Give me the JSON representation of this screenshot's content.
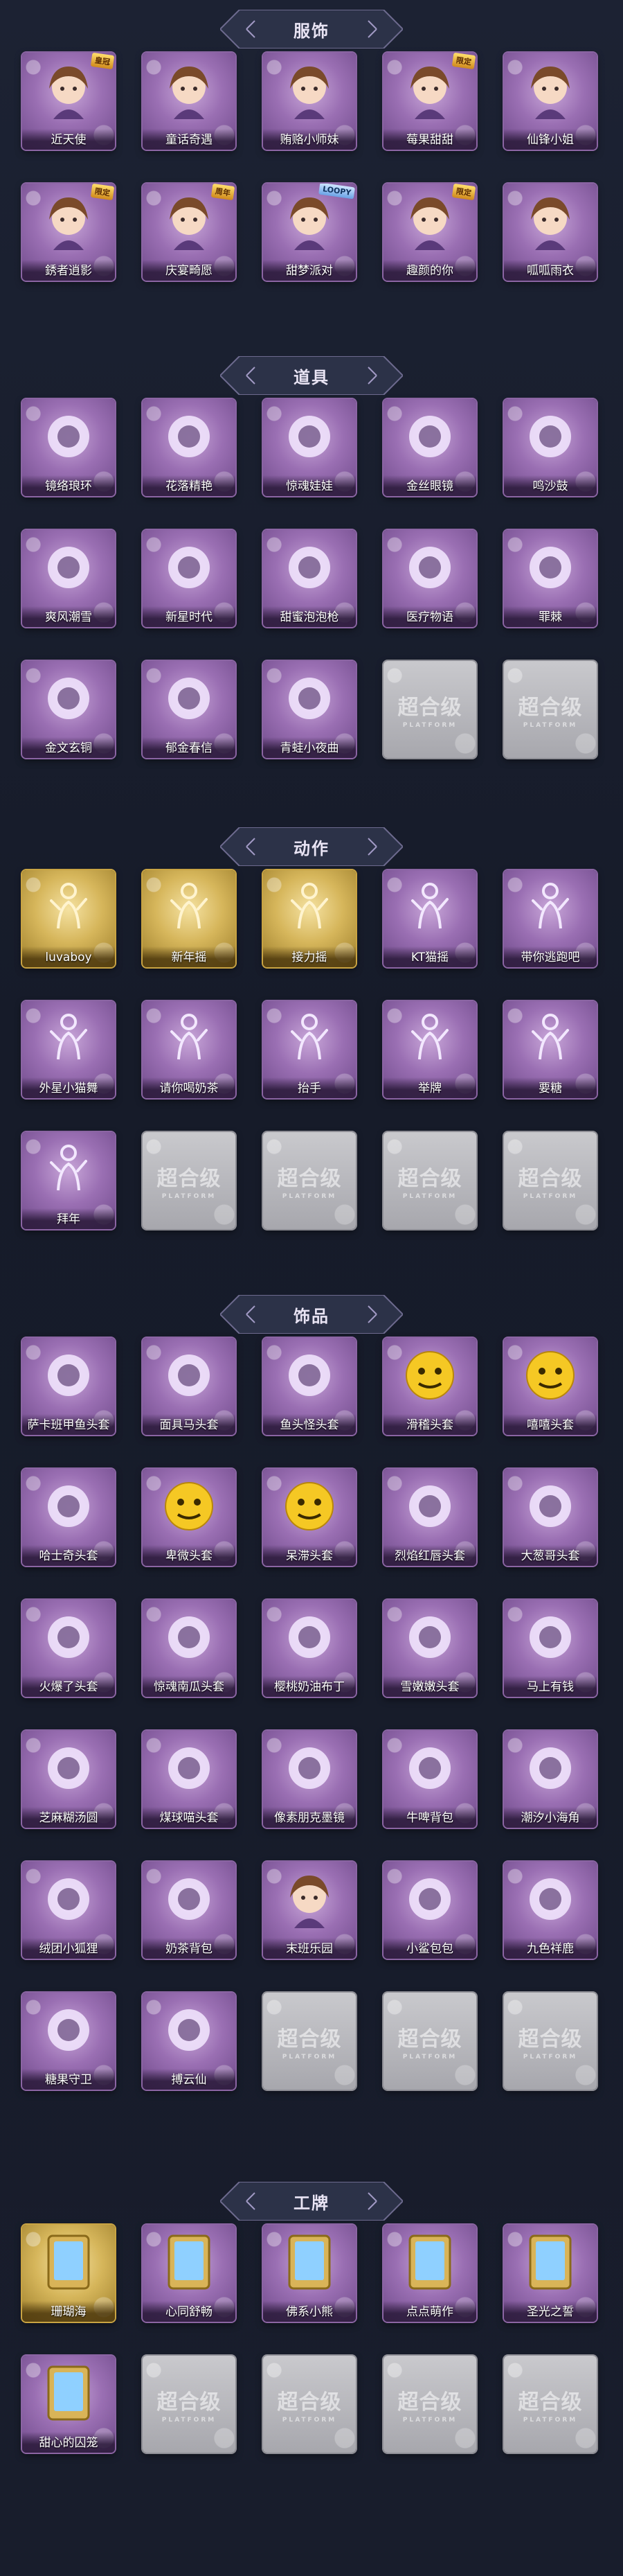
{
  "colors": {
    "background": "#1a1f2e",
    "header_bar": "#2c3248",
    "purple_card": "#9a6fb3",
    "gold_card": "#d6b65b",
    "empty_card": "#b8b8bd"
  },
  "sections": [
    {
      "title": "服饰",
      "items": [
        {
          "name": "近天使",
          "rarity": "purple",
          "badge": "皇冠",
          "icon": "angel-doll-icon"
        },
        {
          "name": "童话奇遇",
          "rarity": "purple",
          "badge": "",
          "icon": "fairy-doll-icon"
        },
        {
          "name": "贿赂小师妹",
          "rarity": "purple",
          "badge": "",
          "icon": "maid-doll-icon"
        },
        {
          "name": "莓果甜甜",
          "rarity": "purple",
          "badge": "限定",
          "icon": "berry-doll-icon"
        },
        {
          "name": "仙锋小姐",
          "rarity": "purple",
          "badge": "",
          "icon": "lady-doll-icon"
        },
        {
          "name": "銹者逍影",
          "rarity": "purple",
          "badge": "限定",
          "icon": "shadow-doll-icon"
        },
        {
          "name": "庆宴畸愿",
          "rarity": "purple",
          "badge": "周年",
          "icon": "cake-doll-icon"
        },
        {
          "name": "甜梦派对",
          "rarity": "purple",
          "badge": "LOOPY",
          "icon": "party-doll-icon"
        },
        {
          "name": "趣颜的你",
          "rarity": "purple",
          "badge": "限定",
          "icon": "cowgirl-doll-icon"
        },
        {
          "name": "呱呱雨衣",
          "rarity": "purple",
          "badge": "",
          "icon": "frog-raincoat-icon"
        }
      ]
    },
    {
      "title": "道具",
      "items": [
        {
          "name": "镜络琅环",
          "rarity": "purple",
          "badge": "",
          "icon": "ring-bow-icon"
        },
        {
          "name": "花落精艳",
          "rarity": "purple",
          "badge": "",
          "icon": "flower-wand-icon"
        },
        {
          "name": "惊魂娃娃",
          "rarity": "purple",
          "badge": "",
          "icon": "skull-ball-icon"
        },
        {
          "name": "金丝眼镜",
          "rarity": "purple",
          "badge": "",
          "icon": "glasses-icon"
        },
        {
          "name": "鸣沙鼓",
          "rarity": "purple",
          "badge": "",
          "icon": "drum-icon"
        },
        {
          "name": "爽风潮雪",
          "rarity": "purple",
          "badge": "",
          "icon": "snow-blower-icon"
        },
        {
          "name": "新星时代",
          "rarity": "purple",
          "badge": "",
          "icon": "revolver-icon"
        },
        {
          "name": "甜蜜泡泡枪",
          "rarity": "purple",
          "badge": "",
          "icon": "bubble-gun-icon"
        },
        {
          "name": "医疗物语",
          "rarity": "purple",
          "badge": "",
          "icon": "medkit-icon"
        },
        {
          "name": "罪棘",
          "rarity": "purple",
          "badge": "",
          "icon": "staff-icon"
        },
        {
          "name": "金文玄铜",
          "rarity": "purple",
          "badge": "",
          "icon": "bronze-vessel-icon"
        },
        {
          "name": "郁金春信",
          "rarity": "purple",
          "badge": "",
          "icon": "paper-fan-icon"
        },
        {
          "name": "青蛙小夜曲",
          "rarity": "purple",
          "badge": "",
          "icon": "frog-icon"
        },
        {
          "name": "",
          "rarity": "empty",
          "badge": "",
          "icon": "empty-slot-icon"
        },
        {
          "name": "",
          "rarity": "empty",
          "badge": "",
          "icon": "empty-slot-icon"
        }
      ]
    },
    {
      "title": "动作",
      "items": [
        {
          "name": "luvaboy",
          "rarity": "gold",
          "badge": "",
          "icon": "pose-figure-icon"
        },
        {
          "name": "新年摇",
          "rarity": "gold",
          "badge": "",
          "icon": "pose-figure-icon"
        },
        {
          "name": "接力摇",
          "rarity": "gold",
          "badge": "",
          "icon": "pose-figure-icon"
        },
        {
          "name": "KT猫摇",
          "rarity": "purple",
          "badge": "",
          "icon": "pose-figure-icon"
        },
        {
          "name": "带你逃跑吧",
          "rarity": "purple",
          "badge": "",
          "icon": "pose-figure-icon"
        },
        {
          "name": "外星小猫舞",
          "rarity": "purple",
          "badge": "",
          "icon": "pose-figure-icon"
        },
        {
          "name": "请你喝奶茶",
          "rarity": "purple",
          "badge": "",
          "icon": "pose-figure-icon"
        },
        {
          "name": "抬手",
          "rarity": "purple",
          "badge": "",
          "icon": "pose-figure-icon"
        },
        {
          "name": "举牌",
          "rarity": "purple",
          "badge": "",
          "icon": "pose-figure-icon"
        },
        {
          "name": "要糖",
          "rarity": "purple",
          "badge": "",
          "icon": "pose-figure-icon"
        },
        {
          "name": "拜年",
          "rarity": "purple",
          "badge": "",
          "icon": "pose-figure-icon"
        },
        {
          "name": "",
          "rarity": "empty",
          "badge": "",
          "icon": "empty-slot-icon"
        },
        {
          "name": "",
          "rarity": "empty",
          "badge": "",
          "icon": "empty-slot-icon"
        },
        {
          "name": "",
          "rarity": "empty",
          "badge": "",
          "icon": "empty-slot-icon"
        },
        {
          "name": "",
          "rarity": "empty",
          "badge": "",
          "icon": "empty-slot-icon"
        }
      ]
    },
    {
      "title": "饰品",
      "items": [
        {
          "name": "萨卡班甲鱼头套",
          "rarity": "purple",
          "badge": "",
          "icon": "fish-head-icon"
        },
        {
          "name": "面具马头套",
          "rarity": "purple",
          "badge": "",
          "icon": "horse-head-icon"
        },
        {
          "name": "鱼头怪头套",
          "rarity": "purple",
          "badge": "",
          "icon": "fish-monster-icon"
        },
        {
          "name": "滑稽头套",
          "rarity": "purple",
          "badge": "",
          "icon": "smirk-face-icon"
        },
        {
          "name": "嘻嘻头套",
          "rarity": "purple",
          "badge": "",
          "icon": "grin-face-icon"
        },
        {
          "name": "哈士奇头套",
          "rarity": "purple",
          "badge": "",
          "icon": "husky-head-icon"
        },
        {
          "name": "卑微头套",
          "rarity": "purple",
          "badge": "",
          "icon": "sad-face-icon"
        },
        {
          "name": "呆滞头套",
          "rarity": "purple",
          "badge": "",
          "icon": "dazed-face-icon"
        },
        {
          "name": "烈焰红唇头套",
          "rarity": "purple",
          "badge": "",
          "icon": "lips-pikachu-icon"
        },
        {
          "name": "大葱哥头套",
          "rarity": "purple",
          "badge": "",
          "icon": "scallion-icon"
        },
        {
          "name": "火爆了头套",
          "rarity": "purple",
          "badge": "",
          "icon": "fire-spirit-icon"
        },
        {
          "name": "惊魂南瓜头套",
          "rarity": "purple",
          "badge": "",
          "icon": "pumpkin-icon"
        },
        {
          "name": "樱桃奶油布丁",
          "rarity": "purple",
          "badge": "",
          "icon": "pudding-icon"
        },
        {
          "name": "雪嫩嫩头套",
          "rarity": "purple",
          "badge": "",
          "icon": "snowman-icon"
        },
        {
          "name": "马上有钱",
          "rarity": "purple",
          "badge": "",
          "icon": "red-horse-icon"
        },
        {
          "name": "芝麻糊汤圆",
          "rarity": "purple",
          "badge": "",
          "icon": "dumpling-icon"
        },
        {
          "name": "煤球喵头套",
          "rarity": "purple",
          "badge": "",
          "icon": "cat-head-icon"
        },
        {
          "name": "像素朋克墨镜",
          "rarity": "purple",
          "badge": "",
          "icon": "pixel-glasses-icon"
        },
        {
          "name": "牛啤背包",
          "rarity": "purple",
          "badge": "",
          "icon": "cow-backpack-icon"
        },
        {
          "name": "潮汐小海角",
          "rarity": "purple",
          "badge": "",
          "icon": "blue-spirit-icon"
        },
        {
          "name": "绒团小狐狸",
          "rarity": "purple",
          "badge": "",
          "icon": "fox-charm-icon"
        },
        {
          "name": "奶茶背包",
          "rarity": "purple",
          "badge": "",
          "icon": "milktea-bag-icon"
        },
        {
          "name": "末班乐园",
          "rarity": "purple",
          "badge": "",
          "icon": "clown-doll-icon"
        },
        {
          "name": "小鲨包包",
          "rarity": "purple",
          "badge": "",
          "icon": "shark-bag-icon"
        },
        {
          "name": "九色祥鹿",
          "rarity": "purple",
          "badge": "",
          "icon": "deer-charm-icon"
        },
        {
          "name": "糖果守卫",
          "rarity": "purple",
          "badge": "",
          "icon": "candy-guard-icon"
        },
        {
          "name": "搏云仙",
          "rarity": "purple",
          "badge": "",
          "icon": "cloud-charm-icon"
        },
        {
          "name": "",
          "rarity": "empty",
          "badge": "",
          "icon": "empty-slot-icon"
        },
        {
          "name": "",
          "rarity": "empty",
          "badge": "",
          "icon": "empty-slot-icon"
        },
        {
          "name": "",
          "rarity": "empty",
          "badge": "",
          "icon": "empty-slot-icon"
        }
      ]
    },
    {
      "title": "工牌",
      "items": [
        {
          "name": "珊瑚海",
          "rarity": "gold",
          "badge": "",
          "icon": "coral-frame-icon"
        },
        {
          "name": "心同舒畅",
          "rarity": "purple",
          "badge": "",
          "icon": "golden-frame-icon"
        },
        {
          "name": "佛系小熊",
          "rarity": "purple",
          "badge": "",
          "icon": "bear-frame-icon"
        },
        {
          "name": "点点萌作",
          "rarity": "purple",
          "badge": "",
          "icon": "flower-frame-icon"
        },
        {
          "name": "圣光之誓",
          "rarity": "purple",
          "badge": "",
          "icon": "holy-frame-icon"
        },
        {
          "name": "甜心的囚笼",
          "rarity": "purple",
          "badge": "",
          "icon": "heart-cage-icon"
        },
        {
          "name": "",
          "rarity": "empty",
          "badge": "",
          "icon": "empty-slot-icon"
        },
        {
          "name": "",
          "rarity": "empty",
          "badge": "",
          "icon": "empty-slot-icon"
        },
        {
          "name": "",
          "rarity": "empty",
          "badge": "",
          "icon": "empty-slot-icon"
        },
        {
          "name": "",
          "rarity": "empty",
          "badge": "",
          "icon": "empty-slot-icon"
        }
      ]
    }
  ],
  "watermark": {
    "main": "超合级",
    "sub": "PLATFORM"
  }
}
